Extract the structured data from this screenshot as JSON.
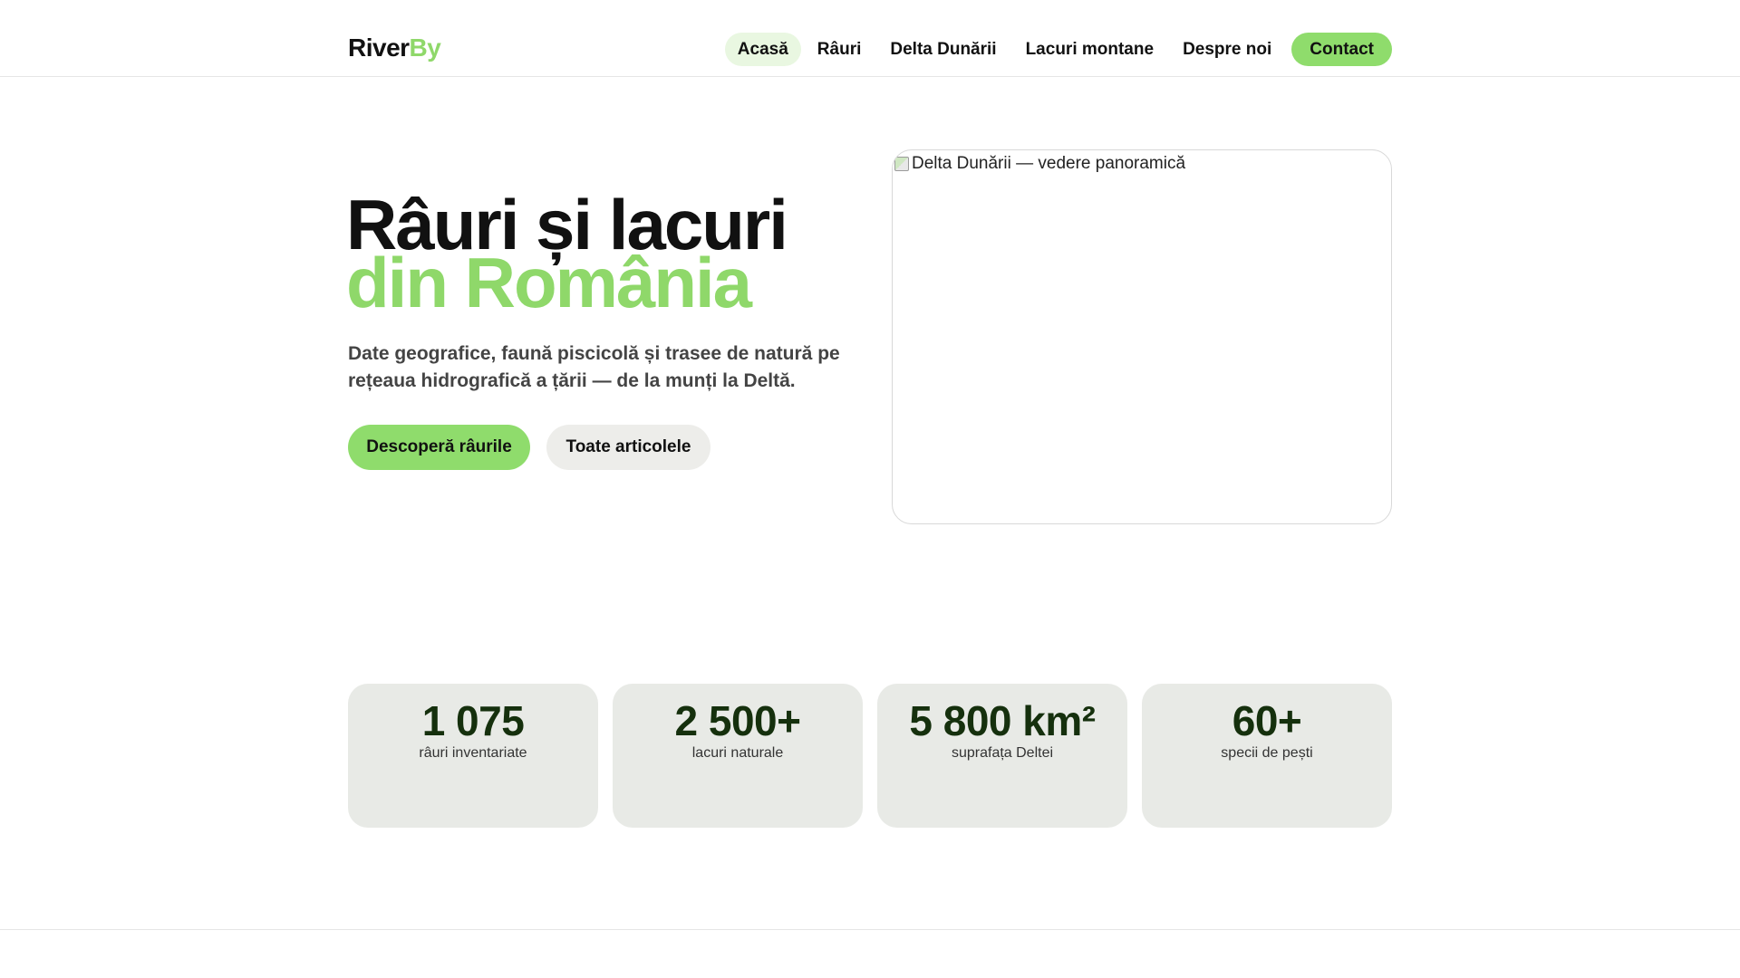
{
  "header": {
    "logo_part1": "River",
    "logo_part2": "By",
    "nav": [
      {
        "label": "Acasă"
      },
      {
        "label": "Râuri"
      },
      {
        "label": "Delta Dunării"
      },
      {
        "label": "Lacuri montane"
      },
      {
        "label": "Despre noi"
      },
      {
        "label": "Contact"
      }
    ]
  },
  "hero": {
    "title_line1": "Râuri și lacuri",
    "title_line2": "din România",
    "subtitle": "Date geografice, faună piscicolă și trasee de natură pe rețeaua hidrografică a țării — de la munți la Deltă.",
    "primary_button": "Descoperă râurile",
    "secondary_button": "Toate articolele",
    "image_alt": "Delta Dunării — vedere panoramică"
  },
  "stats": [
    {
      "value": "1 075",
      "label": "râuri inventariate"
    },
    {
      "value": "2 500+",
      "label": "lacuri naturale"
    },
    {
      "value": "5 800 km²",
      "label": "suprafața Deltei"
    },
    {
      "value": "60+",
      "label": "specii de pești"
    }
  ],
  "colors": {
    "accent": "#8fd86a",
    "accent_button": "#8fdc6c",
    "active_nav_bg": "#e9f7e1",
    "stat_bg": "#e8eae6",
    "stat_value": "#15300d"
  }
}
